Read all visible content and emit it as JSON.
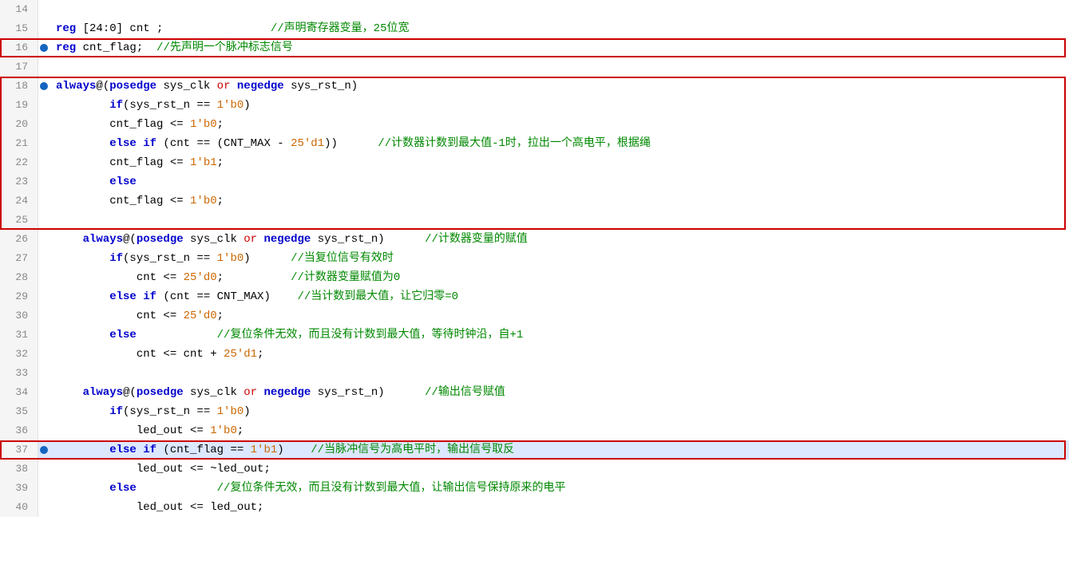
{
  "editor": {
    "lines": [
      {
        "num": 14,
        "breakpoint": false,
        "highlighted": false,
        "tokens": [
          {
            "t": "text",
            "v": "   "
          }
        ]
      },
      {
        "num": 15,
        "breakpoint": false,
        "highlighted": false,
        "tokens": [
          {
            "t": "kw-reg",
            "v": "reg"
          },
          {
            "t": "text",
            "v": " [24:0] cnt ;"
          },
          {
            "t": "comment-green",
            "v": "                //声明寄存器变量，25位宽"
          }
        ]
      },
      {
        "num": 16,
        "breakpoint": true,
        "highlighted": false,
        "tokens": [
          {
            "t": "kw-reg",
            "v": "reg"
          },
          {
            "t": "text",
            "v": " cnt_flag;  "
          },
          {
            "t": "comment-green",
            "v": "//先声明一个脉冲标志信号"
          }
        ]
      },
      {
        "num": 17,
        "breakpoint": false,
        "highlighted": false,
        "tokens": []
      },
      {
        "num": 18,
        "breakpoint": true,
        "highlighted": false,
        "tokens": [
          {
            "t": "kw-always",
            "v": "always"
          },
          {
            "t": "text",
            "v": "@("
          },
          {
            "t": "kw-blue",
            "v": "posedge"
          },
          {
            "t": "text",
            "v": " sys_clk "
          },
          {
            "t": "op-or",
            "v": "or"
          },
          {
            "t": "text",
            "v": " "
          },
          {
            "t": "kw-blue",
            "v": "negedge"
          },
          {
            "t": "text",
            "v": " sys_rst_n)"
          }
        ]
      },
      {
        "num": 19,
        "breakpoint": false,
        "highlighted": false,
        "tokens": [
          {
            "t": "kw-if",
            "v": "        if"
          },
          {
            "t": "text",
            "v": "(sys_rst_n == "
          },
          {
            "t": "num",
            "v": "1'b0"
          },
          {
            "t": "text",
            "v": ")"
          }
        ]
      },
      {
        "num": 20,
        "breakpoint": false,
        "highlighted": false,
        "tokens": [
          {
            "t": "text",
            "v": "        cnt_flag <= "
          },
          {
            "t": "num",
            "v": "1'b0"
          },
          {
            "t": "text",
            "v": ";"
          }
        ]
      },
      {
        "num": 21,
        "breakpoint": false,
        "highlighted": false,
        "tokens": [
          {
            "t": "kw-else",
            "v": "        else "
          },
          {
            "t": "kw-if",
            "v": "if"
          },
          {
            "t": "text",
            "v": " (cnt == (CNT_MAX - "
          },
          {
            "t": "num",
            "v": "25'd1"
          },
          {
            "t": "text",
            "v": "))"
          },
          {
            "t": "comment-green",
            "v": "      //计数器计数到最大值-1时，拉出一个高电平，根据绳"
          }
        ]
      },
      {
        "num": 22,
        "breakpoint": false,
        "highlighted": false,
        "tokens": [
          {
            "t": "text",
            "v": "        cnt_flag <= "
          },
          {
            "t": "num",
            "v": "1'b1"
          },
          {
            "t": "text",
            "v": ";"
          }
        ]
      },
      {
        "num": 23,
        "breakpoint": false,
        "highlighted": false,
        "tokens": [
          {
            "t": "kw-else",
            "v": "        else"
          }
        ]
      },
      {
        "num": 24,
        "breakpoint": false,
        "highlighted": false,
        "tokens": [
          {
            "t": "text",
            "v": "        cnt_flag <= "
          },
          {
            "t": "num",
            "v": "1'b0"
          },
          {
            "t": "text",
            "v": ";"
          }
        ]
      },
      {
        "num": 25,
        "breakpoint": false,
        "highlighted": false,
        "tokens": []
      },
      {
        "num": 26,
        "breakpoint": false,
        "highlighted": false,
        "tokens": [
          {
            "t": "kw-always",
            "v": "    always"
          },
          {
            "t": "text",
            "v": "@("
          },
          {
            "t": "kw-blue",
            "v": "posedge"
          },
          {
            "t": "text",
            "v": " sys_clk "
          },
          {
            "t": "op-or",
            "v": "or"
          },
          {
            "t": "text",
            "v": " "
          },
          {
            "t": "kw-blue",
            "v": "negedge"
          },
          {
            "t": "text",
            "v": " sys_rst_n)"
          },
          {
            "t": "comment-green",
            "v": "      //计数器变量的赋值"
          }
        ]
      },
      {
        "num": 27,
        "breakpoint": false,
        "highlighted": false,
        "tokens": [
          {
            "t": "kw-if",
            "v": "        if"
          },
          {
            "t": "text",
            "v": "(sys_rst_n == "
          },
          {
            "t": "num",
            "v": "1'b0"
          },
          {
            "t": "text",
            "v": ")"
          },
          {
            "t": "comment-green",
            "v": "      //当复位信号有效时"
          }
        ]
      },
      {
        "num": 28,
        "breakpoint": false,
        "highlighted": false,
        "tokens": [
          {
            "t": "text",
            "v": "            cnt <= "
          },
          {
            "t": "num",
            "v": "25'd0"
          },
          {
            "t": "text",
            "v": ";"
          },
          {
            "t": "comment-green",
            "v": "          //计数器变量赋值为0"
          }
        ]
      },
      {
        "num": 29,
        "breakpoint": false,
        "highlighted": false,
        "tokens": [
          {
            "t": "kw-else",
            "v": "        else "
          },
          {
            "t": "kw-if",
            "v": "if"
          },
          {
            "t": "text",
            "v": " (cnt == CNT_MAX)"
          },
          {
            "t": "comment-green",
            "v": "    //当计数到最大值，让它归零=0"
          }
        ]
      },
      {
        "num": 30,
        "breakpoint": false,
        "highlighted": false,
        "tokens": [
          {
            "t": "text",
            "v": "            cnt <= "
          },
          {
            "t": "num",
            "v": "25'd0"
          },
          {
            "t": "text",
            "v": ";"
          }
        ]
      },
      {
        "num": 31,
        "breakpoint": false,
        "highlighted": false,
        "tokens": [
          {
            "t": "kw-else",
            "v": "        else"
          },
          {
            "t": "comment-green",
            "v": "            //复位条件无效，而且没有计数到最大值，等待时钟沿，自+1"
          }
        ]
      },
      {
        "num": 32,
        "breakpoint": false,
        "highlighted": false,
        "tokens": [
          {
            "t": "text",
            "v": "            cnt <= cnt + "
          },
          {
            "t": "num",
            "v": "25'd1"
          },
          {
            "t": "text",
            "v": ";"
          }
        ]
      },
      {
        "num": 33,
        "breakpoint": false,
        "highlighted": false,
        "tokens": []
      },
      {
        "num": 34,
        "breakpoint": false,
        "highlighted": false,
        "tokens": [
          {
            "t": "kw-always",
            "v": "    always"
          },
          {
            "t": "text",
            "v": "@("
          },
          {
            "t": "kw-blue",
            "v": "posedge"
          },
          {
            "t": "text",
            "v": " sys_clk "
          },
          {
            "t": "op-or",
            "v": "or"
          },
          {
            "t": "text",
            "v": " "
          },
          {
            "t": "kw-blue",
            "v": "negedge"
          },
          {
            "t": "text",
            "v": " sys_rst_n)"
          },
          {
            "t": "comment-green",
            "v": "      //输出信号赋值"
          }
        ]
      },
      {
        "num": 35,
        "breakpoint": false,
        "highlighted": false,
        "tokens": [
          {
            "t": "kw-if",
            "v": "        if"
          },
          {
            "t": "text",
            "v": "(sys_rst_n == "
          },
          {
            "t": "num",
            "v": "1'b0"
          },
          {
            "t": "text",
            "v": ")"
          }
        ]
      },
      {
        "num": 36,
        "breakpoint": false,
        "highlighted": false,
        "tokens": [
          {
            "t": "text",
            "v": "            led_out <= "
          },
          {
            "t": "num",
            "v": "1'b0"
          },
          {
            "t": "text",
            "v": ";"
          }
        ]
      },
      {
        "num": 37,
        "breakpoint": true,
        "highlighted": true,
        "tokens": [
          {
            "t": "kw-else",
            "v": "        else "
          },
          {
            "t": "kw-if",
            "v": "if"
          },
          {
            "t": "text",
            "v": " (cnt_flag == "
          },
          {
            "t": "num",
            "v": "1'b1"
          },
          {
            "t": "text",
            "v": ")"
          },
          {
            "t": "comment-green",
            "v": "    //当脉冲信号为高电平时，输出信号取反"
          }
        ]
      },
      {
        "num": 38,
        "breakpoint": false,
        "highlighted": false,
        "tokens": [
          {
            "t": "text",
            "v": "            led_out <= ~led_out;"
          }
        ]
      },
      {
        "num": 39,
        "breakpoint": false,
        "highlighted": false,
        "tokens": [
          {
            "t": "kw-else",
            "v": "        else"
          },
          {
            "t": "comment-green",
            "v": "            //复位条件无效，而且没有计数到最大值，让输出信号保持原来的电平"
          }
        ]
      },
      {
        "num": 40,
        "breakpoint": false,
        "highlighted": false,
        "tokens": [
          {
            "t": "text",
            "v": "            led_out <= led_out;"
          }
        ]
      }
    ],
    "boxes": [
      {
        "id": "box-line16",
        "label": "line 16 box"
      },
      {
        "id": "box-lines18-25",
        "label": "lines 18-25 box"
      },
      {
        "id": "box-line37",
        "label": "line 37 box"
      }
    ]
  }
}
